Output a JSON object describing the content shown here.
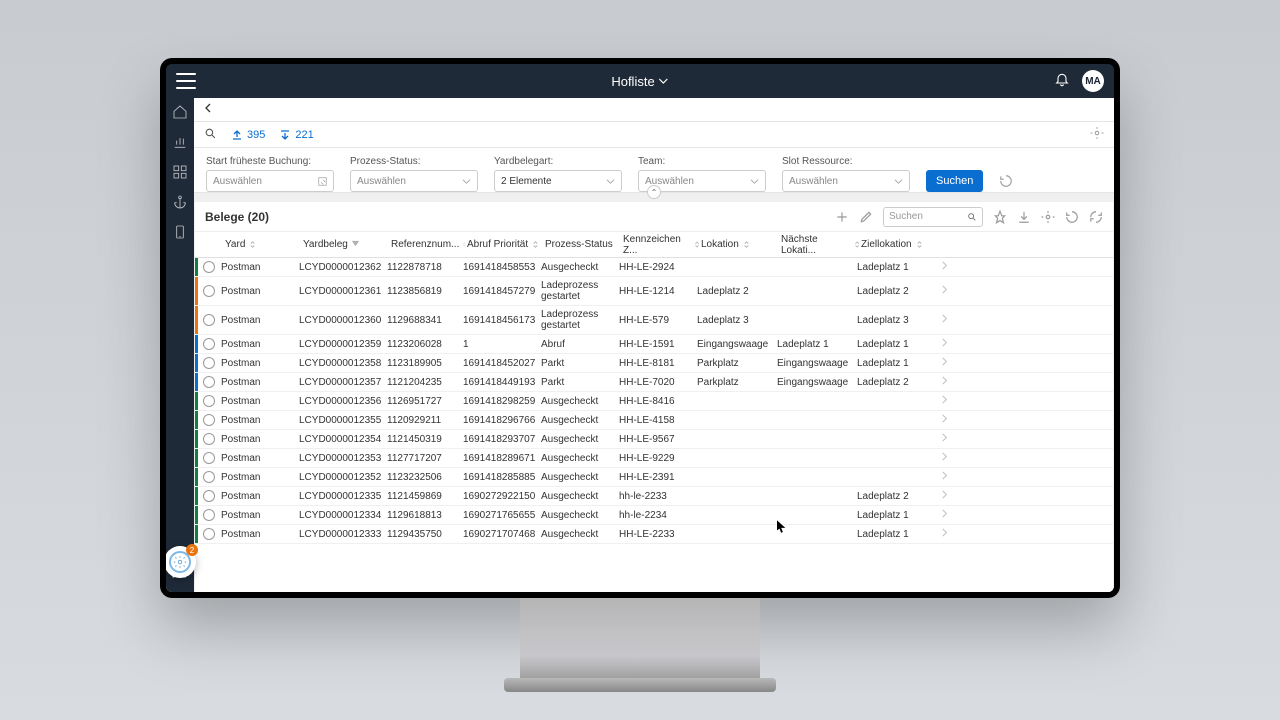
{
  "header": {
    "title": "Hofliste",
    "avatar": "MA"
  },
  "counts": {
    "in": "395",
    "out": "221"
  },
  "filters": {
    "start_label": "Start früheste Buchung:",
    "start_ph": "Auswählen",
    "proc_label": "Prozess-Status:",
    "proc_ph": "Auswählen",
    "yard_label": "Yardbelegart:",
    "yard_val": "2 Elemente",
    "team_label": "Team:",
    "team_ph": "Auswählen",
    "slot_label": "Slot Ressource:",
    "slot_ph": "Auswählen",
    "search_btn": "Suchen"
  },
  "table": {
    "title": "Belege (20)",
    "search_ph": "Suchen",
    "columns": {
      "yard": "Yard",
      "yb": "Yardbeleg",
      "ref": "Referenznum...",
      "prio": "Abruf Priorität",
      "proc": "Prozess-Status",
      "kenn": "Kennzeichen Z...",
      "lok": "Lokation",
      "nlok": "Nächste Lokati...",
      "zlok": "Ziellokation"
    },
    "rows": [
      {
        "stripe": "#107e3e",
        "yard": "Postman",
        "yb": "LCYD0000012362",
        "ref": "1122878718",
        "prio": "1691418458553",
        "proc": "Ausgecheckt",
        "kenn": "HH-LE-2924",
        "lok": "",
        "nlok": "",
        "zlok": "Ladeplatz 1"
      },
      {
        "stripe": "#e9730c",
        "yard": "Postman",
        "yb": "LCYD0000012361",
        "ref": "1123856819",
        "prio": "1691418457279",
        "proc": "Ladeprozess gestartet",
        "kenn": "HH-LE-1214",
        "lok": "Ladeplatz 2",
        "nlok": "",
        "zlok": "Ladeplatz 2"
      },
      {
        "stripe": "#e9730c",
        "yard": "Postman",
        "yb": "LCYD0000012360",
        "ref": "1129688341",
        "prio": "1691418456173",
        "proc": "Ladeprozess gestartet",
        "kenn": "HH-LE-579",
        "lok": "Ladeplatz 3",
        "nlok": "",
        "zlok": "Ladeplatz 3"
      },
      {
        "stripe": "#0a6ed1",
        "yard": "Postman",
        "yb": "LCYD0000012359",
        "ref": "1123206028",
        "prio": "1",
        "proc": "Abruf",
        "kenn": "HH-LE-1591",
        "lok": "Eingangswaage",
        "nlok": "Ladeplatz 1",
        "zlok": "Ladeplatz 1"
      },
      {
        "stripe": "#0a6ed1",
        "yard": "Postman",
        "yb": "LCYD0000012358",
        "ref": "1123189905",
        "prio": "1691418452027",
        "proc": "Parkt",
        "kenn": "HH-LE-8181",
        "lok": "Parkplatz",
        "nlok": "Eingangswaage",
        "zlok": "Ladeplatz 1"
      },
      {
        "stripe": "#0a6ed1",
        "yard": "Postman",
        "yb": "LCYD0000012357",
        "ref": "1121204235",
        "prio": "1691418449193",
        "proc": "Parkt",
        "kenn": "HH-LE-7020",
        "lok": "Parkplatz",
        "nlok": "Eingangswaage",
        "zlok": "Ladeplatz 2"
      },
      {
        "stripe": "#107e3e",
        "yard": "Postman",
        "yb": "LCYD0000012356",
        "ref": "1126951727",
        "prio": "1691418298259",
        "proc": "Ausgecheckt",
        "kenn": "HH-LE-8416",
        "lok": "",
        "nlok": "",
        "zlok": ""
      },
      {
        "stripe": "#107e3e",
        "yard": "Postman",
        "yb": "LCYD0000012355",
        "ref": "1120929211",
        "prio": "1691418296766",
        "proc": "Ausgecheckt",
        "kenn": "HH-LE-4158",
        "lok": "",
        "nlok": "",
        "zlok": ""
      },
      {
        "stripe": "#107e3e",
        "yard": "Postman",
        "yb": "LCYD0000012354",
        "ref": "1121450319",
        "prio": "1691418293707",
        "proc": "Ausgecheckt",
        "kenn": "HH-LE-9567",
        "lok": "",
        "nlok": "",
        "zlok": ""
      },
      {
        "stripe": "#107e3e",
        "yard": "Postman",
        "yb": "LCYD0000012353",
        "ref": "1127717207",
        "prio": "1691418289671",
        "proc": "Ausgecheckt",
        "kenn": "HH-LE-9229",
        "lok": "",
        "nlok": "",
        "zlok": ""
      },
      {
        "stripe": "#107e3e",
        "yard": "Postman",
        "yb": "LCYD0000012352",
        "ref": "1123232506",
        "prio": "1691418285885",
        "proc": "Ausgecheckt",
        "kenn": "HH-LE-2391",
        "lok": "",
        "nlok": "",
        "zlok": ""
      },
      {
        "stripe": "#107e3e",
        "yard": "Postman",
        "yb": "LCYD0000012335",
        "ref": "1121459869",
        "prio": "1690272922150",
        "proc": "Ausgecheckt",
        "kenn": "hh-le-2233",
        "lok": "",
        "nlok": "",
        "zlok": "Ladeplatz 2"
      },
      {
        "stripe": "#107e3e",
        "yard": "Postman",
        "yb": "LCYD0000012334",
        "ref": "1129618813",
        "prio": "1690271765655",
        "proc": "Ausgecheckt",
        "kenn": "hh-le-2234",
        "lok": "",
        "nlok": "",
        "zlok": "Ladeplatz 1"
      },
      {
        "stripe": "#107e3e",
        "yard": "Postman",
        "yb": "LCYD0000012333",
        "ref": "1129435750",
        "prio": "1690271707468",
        "proc": "Ausgecheckt",
        "kenn": "HH-LE-2233",
        "lok": "",
        "nlok": "",
        "zlok": "Ladeplatz 1"
      }
    ]
  },
  "copilot_badge": "2"
}
